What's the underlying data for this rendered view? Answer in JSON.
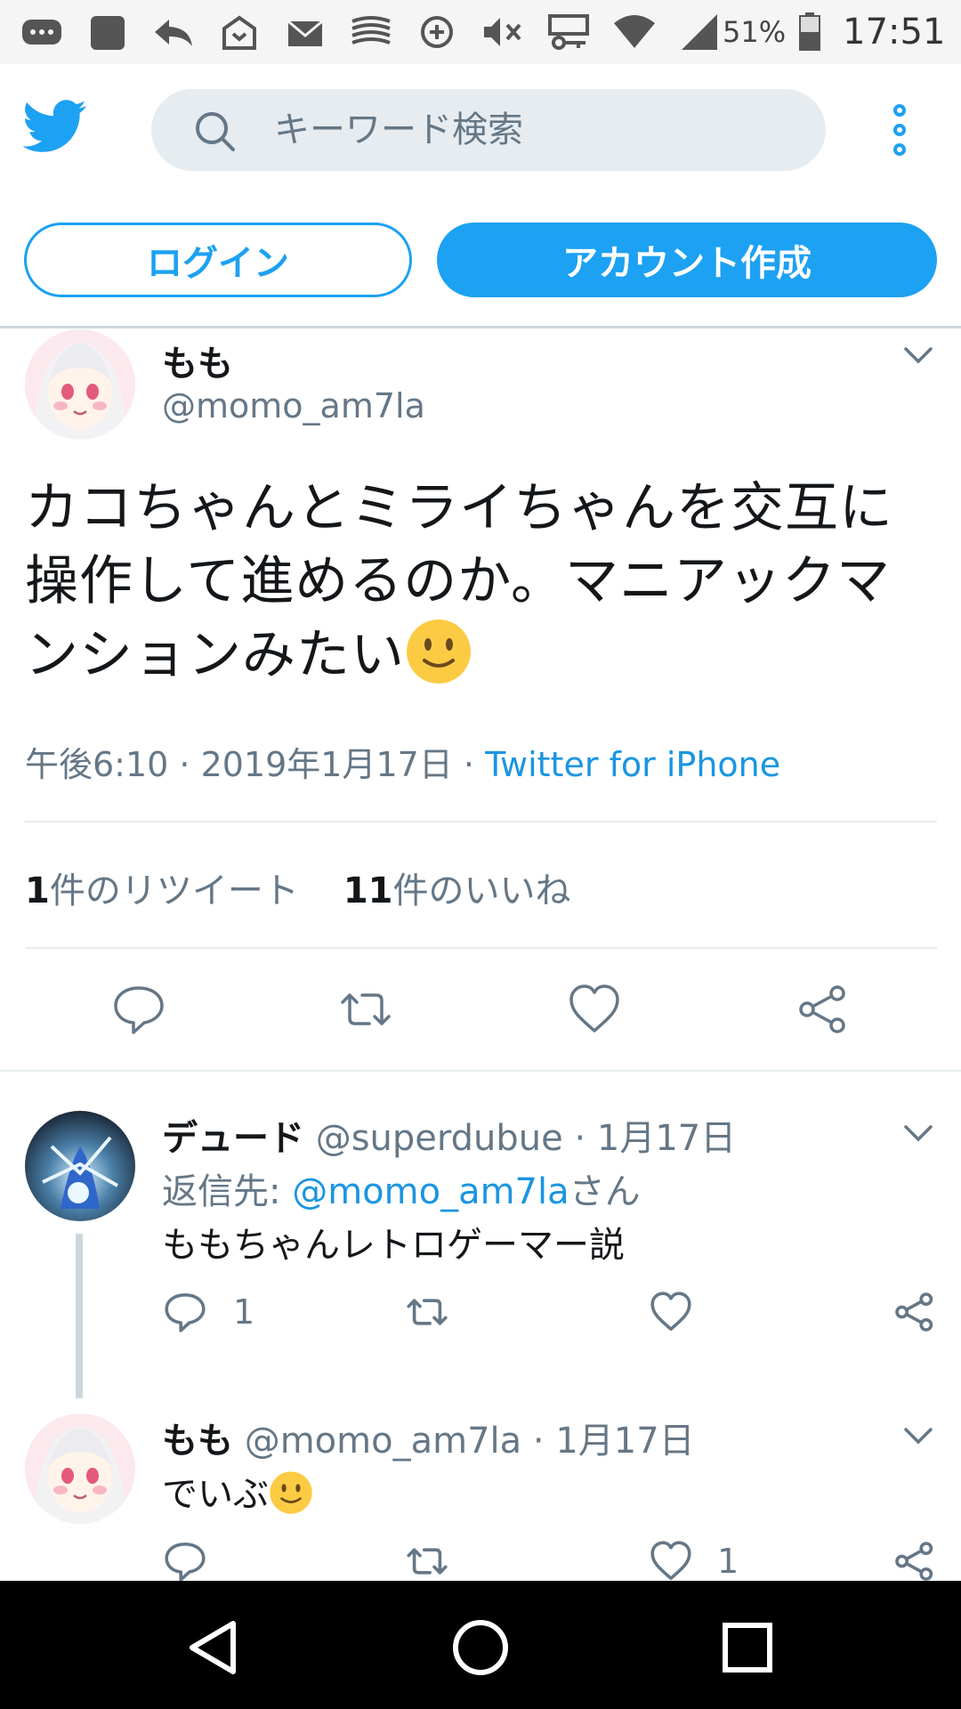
{
  "status_bar": {
    "battery_percent": "51%",
    "time": "17:51"
  },
  "search": {
    "placeholder": "キーワード検索"
  },
  "auth": {
    "login_label": "ログイン",
    "signup_label": "アカウント作成"
  },
  "main_tweet": {
    "name": "もも",
    "handle": "@momo_am7la",
    "text": "カコちゃんとミライちゃんを交互に操作して進めるのか。マニアックマンションみたい",
    "time": "午後6:10",
    "sep1": " · ",
    "date": "2019年1月17日",
    "sep2": " · ",
    "source": "Twitter for iPhone",
    "retweet_count": "1",
    "retweet_label": "件のリツイート",
    "like_count": "11",
    "like_label": "件のいいね"
  },
  "replies": [
    {
      "name": "デュード",
      "handle": "@superdubue",
      "dot": " · ",
      "date": "1月17日",
      "reply_to_prefix": "返信先: ",
      "reply_to_mention": "@momo_am7la",
      "reply_to_suffix": "さん",
      "text": "ももちゃんレトロゲーマー説",
      "reply_count": "1",
      "like_count": ""
    },
    {
      "name": "もも",
      "handle": "@momo_am7la",
      "dot": " · ",
      "date": "1月17日",
      "text": "でいぶ",
      "reply_count": "",
      "like_count": "1"
    }
  ],
  "colors": {
    "brand": "#1da1f2",
    "link": "#1b95e0",
    "secondary_text": "#657786"
  },
  "icons": [
    "twitter-bird-icon",
    "search-icon",
    "more-vertical-icon",
    "chevron-down-icon",
    "reply-icon",
    "retweet-icon",
    "like-icon",
    "share-icon",
    "back-icon",
    "home-icon",
    "recents-icon"
  ]
}
